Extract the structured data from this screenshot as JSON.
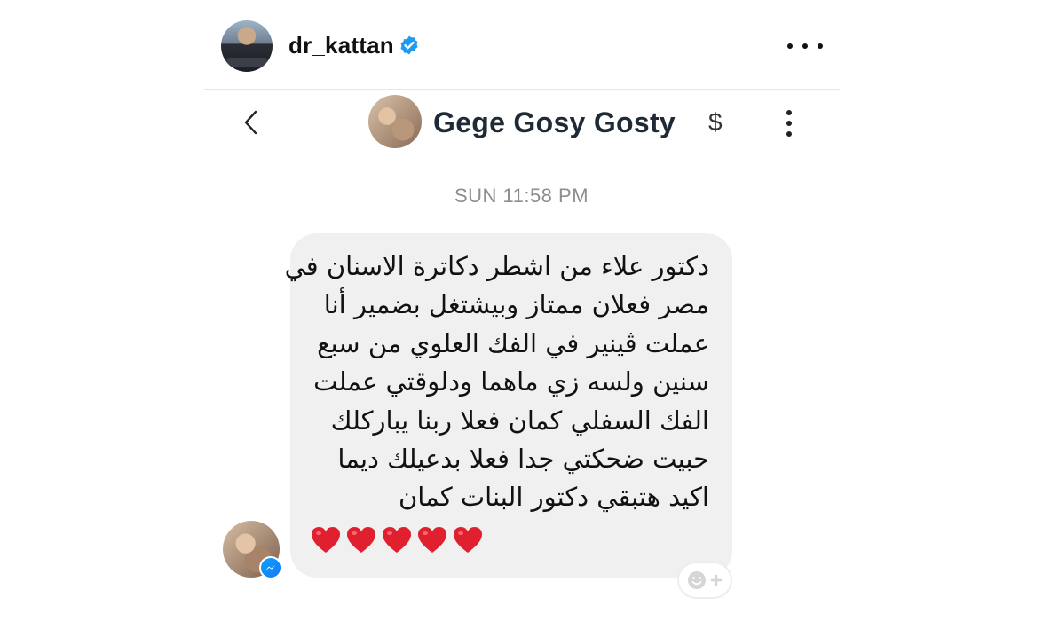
{
  "header": {
    "username": "dr_kattan"
  },
  "chat": {
    "contact_name": "Gege Gosy Gosty",
    "dollar_symbol": "$"
  },
  "timestamp": "SUN 11:58 PM",
  "message": {
    "lines": [
      "دكتور علاء من اشطر دكاترة الاسنان في",
      "مصر فعلان ممتاز وبيشتغل بضمير أنا",
      "عملت ڤينير في الفك العلوي من سبع",
      "سنين ولسه زي ماهما ودلوقتي عملت",
      "الفك السفلي كمان فعلا ربنا يباركلك",
      "حبيت ضحكتي جدا   فعلا بدعيلك ديما",
      "اكيد هتبقي دكتور البنات كمان"
    ],
    "hearts": [
      "heart-icon",
      "heart-icon",
      "heart-icon",
      "heart-icon",
      "heart-icon"
    ]
  },
  "colors": {
    "verified_blue": "#1d9bf0",
    "heart_red": "#e0202e",
    "bubble_bg": "#f0f0f0",
    "timestamp_gray": "#8e8e8e"
  }
}
